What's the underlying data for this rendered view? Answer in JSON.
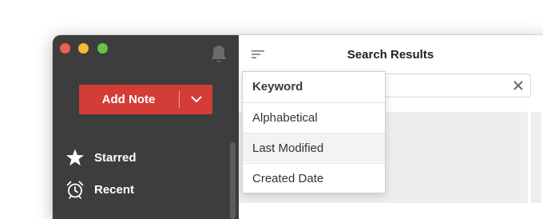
{
  "sidebar": {
    "add_note_label": "Add Note",
    "items": [
      {
        "label": "Starred",
        "icon": "star-icon"
      },
      {
        "label": "Recent",
        "icon": "alarm-clock-icon"
      }
    ]
  },
  "main": {
    "title": "Search Results",
    "search": {
      "value": "",
      "placeholder": ""
    }
  },
  "sort_menu": {
    "options": [
      {
        "label": "Keyword",
        "selected": true
      },
      {
        "label": "Alphabetical",
        "selected": false
      },
      {
        "label": "Last Modified",
        "selected": false,
        "hovered": true
      },
      {
        "label": "Created Date",
        "selected": false
      }
    ]
  },
  "colors": {
    "sidebar_bg": "#3d3d3d",
    "accent_red": "#d43c38",
    "traffic_close": "#ee5e55",
    "traffic_minimize": "#f5bc31",
    "traffic_maximize": "#5fc743"
  }
}
